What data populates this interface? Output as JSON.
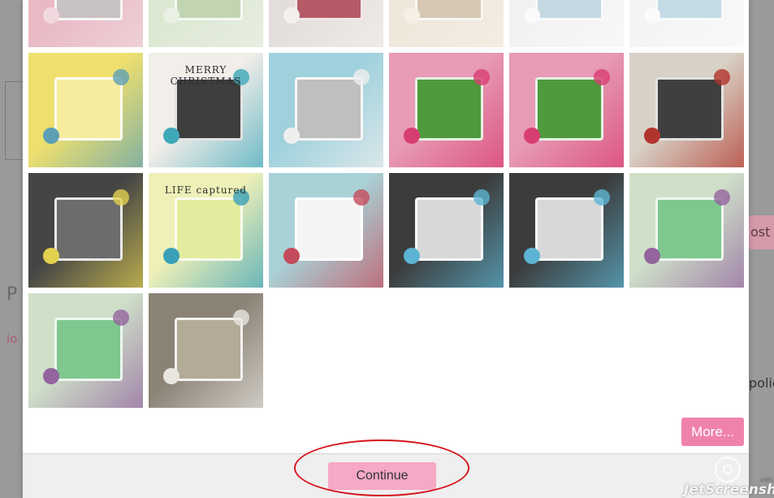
{
  "background": {
    "left_glyph_pin": "P",
    "left_frag_io": "io",
    "right_button_text": "ost n",
    "right_text_fragment": "polic"
  },
  "gallery": {
    "rows": [
      [
        {
          "label": "",
          "colors": [
            "#e9b9c4",
            "#c9c2c4",
            "#f0d8de"
          ]
        },
        {
          "label": "",
          "colors": [
            "#dde8d3",
            "#c2d5b3",
            "#eaf0e4"
          ]
        },
        {
          "label": "",
          "colors": [
            "#e3dedb",
            "#b55a66",
            "#f3f0ee"
          ]
        },
        {
          "label": "",
          "colors": [
            "#efe7da",
            "#d6c8b3",
            "#f5efe6"
          ]
        },
        {
          "label": "",
          "colors": [
            "#f2f2f2",
            "#c5d9e3",
            "#fafafa"
          ]
        },
        {
          "label": "",
          "colors": [
            "#f4f4f4",
            "#c5dbe6",
            "#fbfbfb"
          ]
        }
      ],
      [
        {
          "label": "",
          "colors": [
            "#efe06e",
            "#f5ec9e",
            "#5da0b4"
          ]
        },
        {
          "label": "MERRY CHRISTMAS",
          "colors": [
            "#f2eee9",
            "#3e3e3e",
            "#3fa8b9"
          ]
        },
        {
          "label": "",
          "colors": [
            "#9fd1dc",
            "#bfbfbf",
            "#efefef"
          ]
        },
        {
          "label": "",
          "colors": [
            "#e79bb4",
            "#4f9a3c",
            "#d83d73"
          ]
        },
        {
          "label": "",
          "colors": [
            "#e79bb4",
            "#4f9a3c",
            "#d83d73"
          ]
        },
        {
          "label": "",
          "colors": [
            "#d8d2c6",
            "#3f3f3f",
            "#b2352d"
          ]
        }
      ],
      [
        {
          "label": "",
          "colors": [
            "#454545",
            "#6c6c6c",
            "#e2d14f"
          ]
        },
        {
          "label": "LIFE captured",
          "colors": [
            "#eef0b8",
            "#e3ec9e",
            "#3aa0b8"
          ]
        },
        {
          "label": "",
          "colors": [
            "#a9d2d7",
            "#f4f4f4",
            "#c44b5b"
          ]
        },
        {
          "label": "",
          "colors": [
            "#3c3c3c",
            "#d8d8d8",
            "#5cb4d2"
          ]
        },
        {
          "label": "",
          "colors": [
            "#3c3c3c",
            "#d8d8d8",
            "#5cb4d2"
          ]
        },
        {
          "label": "",
          "colors": [
            "#cfe0c9",
            "#7fc78f",
            "#93649e"
          ]
        }
      ],
      [
        {
          "label": "",
          "colors": [
            "#cfe0c9",
            "#7fc78f",
            "#93649e"
          ]
        },
        {
          "label": "",
          "colors": [
            "#8a8275",
            "#b3aa98",
            "#e9e6e0"
          ]
        }
      ]
    ]
  },
  "actions": {
    "more_label": "More...",
    "continue_label": "Continue"
  },
  "watermark": {
    "text": "JetScreenshot",
    "small": ".com"
  }
}
